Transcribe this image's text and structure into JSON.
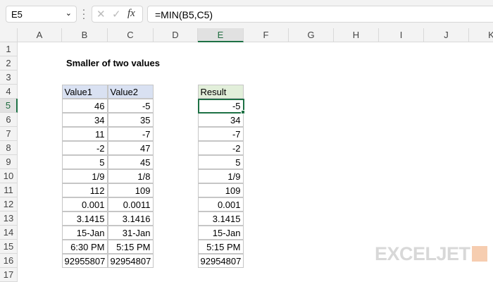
{
  "formula_bar": {
    "name_box": "E5",
    "cancel_icon": "✕",
    "enter_icon": "✓",
    "fx_label": "fx",
    "formula": "=MIN(B5,C5)"
  },
  "columns": [
    "A",
    "B",
    "C",
    "D",
    "E",
    "F",
    "G",
    "H",
    "I",
    "J",
    "K"
  ],
  "rows": [
    "1",
    "2",
    "3",
    "4",
    "5",
    "6",
    "7",
    "8",
    "9",
    "10",
    "11",
    "12",
    "13",
    "14",
    "15",
    "16",
    "17"
  ],
  "title": "Smaller of two values",
  "table": {
    "headers": [
      "Value1",
      "Value2"
    ],
    "rows": [
      [
        "46",
        "-5"
      ],
      [
        "34",
        "35"
      ],
      [
        "11",
        "-7"
      ],
      [
        "-2",
        "47"
      ],
      [
        "5",
        "45"
      ],
      [
        "1/9",
        "1/8"
      ],
      [
        "112",
        "109"
      ],
      [
        "0.001",
        "0.0011"
      ],
      [
        "3.1415",
        "3.1416"
      ],
      [
        "15-Jan",
        "31-Jan"
      ],
      [
        "6:30 PM",
        "5:15 PM"
      ],
      [
        "92955807",
        "92954807"
      ]
    ]
  },
  "result": {
    "header": "Result",
    "values": [
      "-5",
      "34",
      "-7",
      "-2",
      "5",
      "1/9",
      "109",
      "0.001",
      "3.1415",
      "15-Jan",
      "5:15 PM",
      "92954807"
    ]
  },
  "logo": "EXCELJET"
}
